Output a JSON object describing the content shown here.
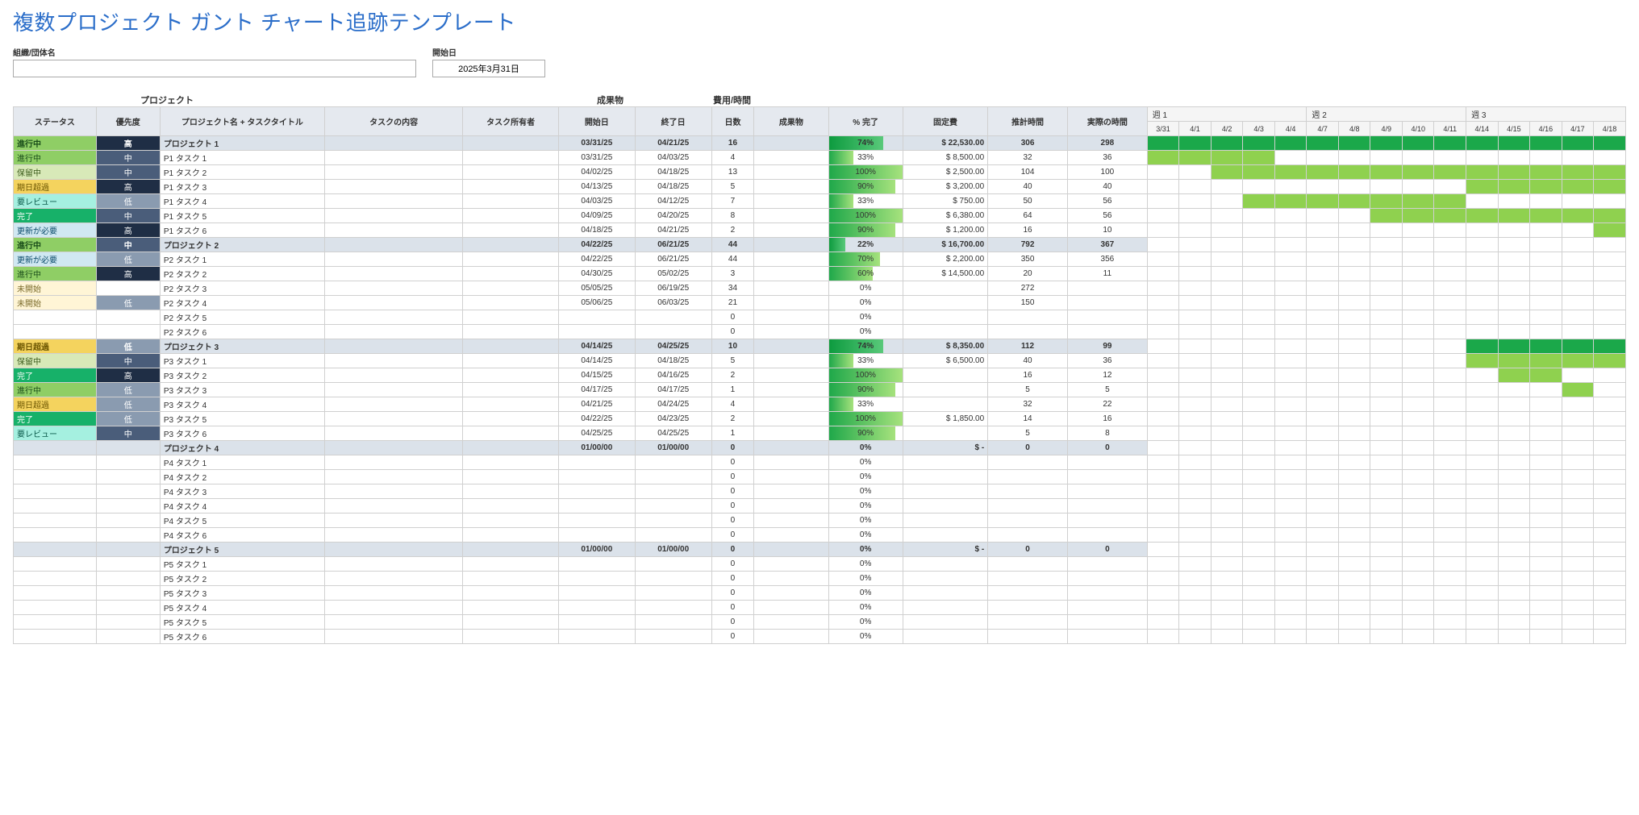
{
  "title": "複数プロジェクト ガント チャート追跡テンプレート",
  "meta": {
    "org_label": "組織/団体名",
    "org_value": "",
    "start_date_label": "開始日",
    "start_date_value": "2025年3月31日"
  },
  "sections": {
    "project": "プロジェクト",
    "deliverable": "成果物",
    "cost": "費用/時間"
  },
  "headers": {
    "status": "ステータス",
    "priority": "優先度",
    "name": "プロジェクト名 + タスクタイトル",
    "content": "タスクの内容",
    "owner": "タスク所有者",
    "start": "開始日",
    "end": "終了日",
    "days": "日数",
    "deliverable": "成果物",
    "pct": "% 完了",
    "fixed_cost": "固定費",
    "est_hours": "推計時間",
    "actual_hours": "実際の時間"
  },
  "weeks": [
    {
      "label": "週 1",
      "days": [
        "3/31",
        "4/1",
        "4/2",
        "4/3",
        "4/4"
      ]
    },
    {
      "label": "週 2",
      "days": [
        "4/7",
        "4/8",
        "4/9",
        "4/10",
        "4/11"
      ]
    },
    {
      "label": "週 3",
      "days": [
        "4/14",
        "4/15",
        "4/16",
        "4/17",
        "4/18"
      ]
    }
  ],
  "rows": [
    {
      "type": "proj",
      "status": "進行中",
      "prio": "高",
      "name": "プロジェクト 1",
      "start": "03/31/25",
      "end": "04/21/25",
      "days": "16",
      "pct": 74,
      "cost": "$    22,530.00",
      "est": "306",
      "act": "298",
      "gantt": [
        1,
        2,
        3,
        4,
        5,
        6,
        7,
        8,
        9,
        10,
        11,
        12,
        13,
        14,
        15
      ]
    },
    {
      "type": "task",
      "status": "進行中",
      "prio": "中",
      "name": "P1 タスク 1",
      "start": "03/31/25",
      "end": "04/03/25",
      "days": "4",
      "pct": 33,
      "cost": "$      8,500.00",
      "est": "32",
      "act": "36",
      "gantt": [
        1,
        2,
        3,
        4
      ]
    },
    {
      "type": "task",
      "status": "保留中",
      "prio": "中",
      "name": "P1 タスク 2",
      "start": "04/02/25",
      "end": "04/18/25",
      "days": "13",
      "pct": 100,
      "cost": "$      2,500.00",
      "est": "104",
      "act": "100",
      "gantt": [
        3,
        4,
        5,
        6,
        7,
        8,
        9,
        10,
        11,
        12,
        13,
        14,
        15
      ]
    },
    {
      "type": "task",
      "status": "期日超過",
      "prio": "高",
      "name": "P1 タスク 3",
      "start": "04/13/25",
      "end": "04/18/25",
      "days": "5",
      "pct": 90,
      "cost": "$      3,200.00",
      "est": "40",
      "act": "40",
      "gantt": [
        11,
        12,
        13,
        14,
        15
      ]
    },
    {
      "type": "task",
      "status": "要レビュー",
      "prio": "低",
      "name": "P1 タスク 4",
      "start": "04/03/25",
      "end": "04/12/25",
      "days": "7",
      "pct": 33,
      "cost": "$         750.00",
      "est": "50",
      "act": "56",
      "gantt": [
        4,
        5,
        6,
        7,
        8,
        9,
        10
      ]
    },
    {
      "type": "task",
      "status": "完了",
      "prio": "中",
      "name": "P1 タスク 5",
      "start": "04/09/25",
      "end": "04/20/25",
      "days": "8",
      "pct": 100,
      "cost": "$      6,380.00",
      "est": "64",
      "act": "56",
      "gantt": [
        8,
        9,
        10,
        11,
        12,
        13,
        14,
        15
      ]
    },
    {
      "type": "task",
      "status": "更新が必要",
      "prio": "高",
      "name": "P1 タスク 6",
      "start": "04/18/25",
      "end": "04/21/25",
      "days": "2",
      "pct": 90,
      "cost": "$      1,200.00",
      "est": "16",
      "act": "10",
      "gantt": [
        15
      ]
    },
    {
      "type": "proj",
      "status": "進行中",
      "prio": "中",
      "name": "プロジェクト 2",
      "start": "04/22/25",
      "end": "06/21/25",
      "days": "44",
      "pct": 22,
      "cost": "$   16,700.00",
      "est": "792",
      "act": "367",
      "gantt": []
    },
    {
      "type": "task",
      "status": "更新が必要",
      "prio": "低",
      "name": "P2 タスク 1",
      "start": "04/22/25",
      "end": "06/21/25",
      "days": "44",
      "pct": 70,
      "cost": "$      2,200.00",
      "est": "350",
      "act": "356",
      "gantt": []
    },
    {
      "type": "task",
      "status": "進行中",
      "prio": "高",
      "name": "P2 タスク 2",
      "start": "04/30/25",
      "end": "05/02/25",
      "days": "3",
      "pct": 60,
      "cost": "$    14,500.00",
      "est": "20",
      "act": "11",
      "gantt": []
    },
    {
      "type": "task",
      "status": "未開始",
      "prio": "",
      "name": "P2 タスク 3",
      "start": "05/05/25",
      "end": "06/19/25",
      "days": "34",
      "pct": 0,
      "cost": "",
      "est": "272",
      "act": "",
      "gantt": []
    },
    {
      "type": "task",
      "status": "未開始",
      "prio": "低",
      "name": "P2 タスク 4",
      "start": "05/06/25",
      "end": "06/03/25",
      "days": "21",
      "pct": 0,
      "cost": "",
      "est": "150",
      "act": "",
      "gantt": []
    },
    {
      "type": "task",
      "status": "",
      "prio": "",
      "name": "P2 タスク 5",
      "start": "",
      "end": "",
      "days": "0",
      "pct": 0,
      "cost": "",
      "est": "",
      "act": "",
      "gantt": []
    },
    {
      "type": "task",
      "status": "",
      "prio": "",
      "name": "P2 タスク 6",
      "start": "",
      "end": "",
      "days": "0",
      "pct": 0,
      "cost": "",
      "est": "",
      "act": "",
      "gantt": []
    },
    {
      "type": "proj",
      "status": "期日超過",
      "prio": "低",
      "name": "プロジェクト 3",
      "start": "04/14/25",
      "end": "04/25/25",
      "days": "10",
      "pct": 74,
      "cost": "$      8,350.00",
      "est": "112",
      "act": "99",
      "gantt": [
        11,
        12,
        13,
        14,
        15
      ]
    },
    {
      "type": "task",
      "status": "保留中",
      "prio": "中",
      "name": "P3 タスク 1",
      "start": "04/14/25",
      "end": "04/18/25",
      "days": "5",
      "pct": 33,
      "cost": "$      6,500.00",
      "est": "40",
      "act": "36",
      "gantt": [
        11,
        12,
        13,
        14,
        15
      ]
    },
    {
      "type": "task",
      "status": "完了",
      "prio": "高",
      "name": "P3 タスク 2",
      "start": "04/15/25",
      "end": "04/16/25",
      "days": "2",
      "pct": 100,
      "cost": "",
      "est": "16",
      "act": "12",
      "gantt": [
        12,
        13
      ]
    },
    {
      "type": "task",
      "status": "進行中",
      "prio": "低",
      "name": "P3 タスク 3",
      "start": "04/17/25",
      "end": "04/17/25",
      "days": "1",
      "pct": 90,
      "cost": "",
      "est": "5",
      "act": "5",
      "gantt": [
        14
      ]
    },
    {
      "type": "task",
      "status": "期日超過",
      "prio": "低",
      "name": "P3 タスク 4",
      "start": "04/21/25",
      "end": "04/24/25",
      "days": "4",
      "pct": 33,
      "cost": "",
      "est": "32",
      "act": "22",
      "gantt": []
    },
    {
      "type": "task",
      "status": "完了",
      "prio": "低",
      "name": "P3 タスク 5",
      "start": "04/22/25",
      "end": "04/23/25",
      "days": "2",
      "pct": 100,
      "cost": "$      1,850.00",
      "est": "14",
      "act": "16",
      "gantt": []
    },
    {
      "type": "task",
      "status": "要レビュー",
      "prio": "中",
      "name": "P3 タスク 6",
      "start": "04/25/25",
      "end": "04/25/25",
      "days": "1",
      "pct": 90,
      "cost": "",
      "est": "5",
      "act": "8",
      "gantt": []
    },
    {
      "type": "proj",
      "status": "",
      "prio": "",
      "name": "プロジェクト 4",
      "start": "01/00/00",
      "end": "01/00/00",
      "days": "0",
      "pct": 0,
      "cost": "$            -",
      "est": "0",
      "act": "0",
      "gantt": []
    },
    {
      "type": "task",
      "status": "",
      "prio": "",
      "name": "P4 タスク 1",
      "start": "",
      "end": "",
      "days": "0",
      "pct": 0,
      "cost": "",
      "est": "",
      "act": "",
      "gantt": []
    },
    {
      "type": "task",
      "status": "",
      "prio": "",
      "name": "P4 タスク 2",
      "start": "",
      "end": "",
      "days": "0",
      "pct": 0,
      "cost": "",
      "est": "",
      "act": "",
      "gantt": []
    },
    {
      "type": "task",
      "status": "",
      "prio": "",
      "name": "P4 タスク 3",
      "start": "",
      "end": "",
      "days": "0",
      "pct": 0,
      "cost": "",
      "est": "",
      "act": "",
      "gantt": []
    },
    {
      "type": "task",
      "status": "",
      "prio": "",
      "name": "P4 タスク 4",
      "start": "",
      "end": "",
      "days": "0",
      "pct": 0,
      "cost": "",
      "est": "",
      "act": "",
      "gantt": []
    },
    {
      "type": "task",
      "status": "",
      "prio": "",
      "name": "P4 タスク 5",
      "start": "",
      "end": "",
      "days": "0",
      "pct": 0,
      "cost": "",
      "est": "",
      "act": "",
      "gantt": []
    },
    {
      "type": "task",
      "status": "",
      "prio": "",
      "name": "P4 タスク 6",
      "start": "",
      "end": "",
      "days": "0",
      "pct": 0,
      "cost": "",
      "est": "",
      "act": "",
      "gantt": []
    },
    {
      "type": "proj",
      "status": "",
      "prio": "",
      "name": "プロジェクト 5",
      "start": "01/00/00",
      "end": "01/00/00",
      "days": "0",
      "pct": 0,
      "cost": "$            -",
      "est": "0",
      "act": "0",
      "gantt": []
    },
    {
      "type": "task",
      "status": "",
      "prio": "",
      "name": "P5 タスク 1",
      "start": "",
      "end": "",
      "days": "0",
      "pct": 0,
      "cost": "",
      "est": "",
      "act": "",
      "gantt": []
    },
    {
      "type": "task",
      "status": "",
      "prio": "",
      "name": "P5 タスク 2",
      "start": "",
      "end": "",
      "days": "0",
      "pct": 0,
      "cost": "",
      "est": "",
      "act": "",
      "gantt": []
    },
    {
      "type": "task",
      "status": "",
      "prio": "",
      "name": "P5 タスク 3",
      "start": "",
      "end": "",
      "days": "0",
      "pct": 0,
      "cost": "",
      "est": "",
      "act": "",
      "gantt": []
    },
    {
      "type": "task",
      "status": "",
      "prio": "",
      "name": "P5 タスク 4",
      "start": "",
      "end": "",
      "days": "0",
      "pct": 0,
      "cost": "",
      "est": "",
      "act": "",
      "gantt": []
    },
    {
      "type": "task",
      "status": "",
      "prio": "",
      "name": "P5 タスク 5",
      "start": "",
      "end": "",
      "days": "0",
      "pct": 0,
      "cost": "",
      "est": "",
      "act": "",
      "gantt": []
    },
    {
      "type": "task",
      "status": "",
      "prio": "",
      "name": "P5 タスク 6",
      "start": "",
      "end": "",
      "days": "0",
      "pct": 0,
      "cost": "",
      "est": "",
      "act": "",
      "gantt": []
    }
  ]
}
